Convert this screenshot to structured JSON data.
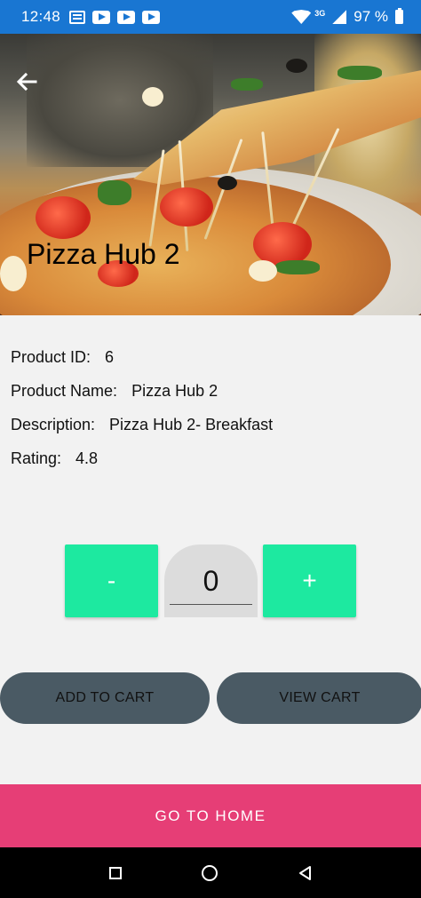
{
  "status_bar": {
    "time": "12:48",
    "network": "3G",
    "battery": "97 %"
  },
  "hero": {
    "title": "Pizza Hub 2"
  },
  "details": {
    "product_id_label": "Product ID:",
    "product_id": "6",
    "product_name_label": "Product Name:",
    "product_name": "Pizza Hub 2",
    "description_label": "Description:",
    "description": "Pizza Hub 2- Breakfast",
    "rating_label": "Rating:",
    "rating": "4.8"
  },
  "quantity": {
    "minus_label": "-",
    "value": "0",
    "plus_label": "+"
  },
  "actions": {
    "add_to_cart": "ADD TO CART",
    "view_cart": "VIEW CART",
    "go_home": "GO TO HOME"
  },
  "colors": {
    "status_bar": "#1976d2",
    "qty_button": "#1de9a0",
    "cart_button": "#4a5a64",
    "home_button": "#e63e76"
  }
}
